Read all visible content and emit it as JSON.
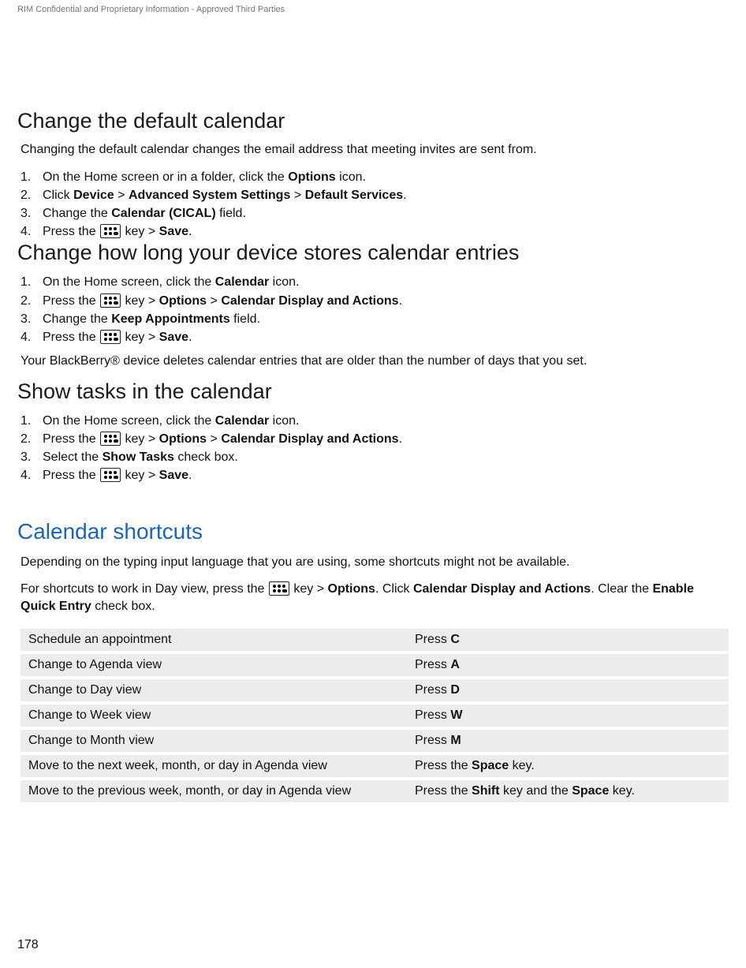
{
  "header": "RIM Confidential and Proprietary Information - Approved Third Parties",
  "page_number": "178",
  "key_label": "key",
  "gt": ">",
  "sections": {
    "s1": {
      "title": "Change the default calendar",
      "intro": "Changing the default calendar changes the email address that meeting invites are sent from.",
      "step1_a": "On the Home screen or in a folder, click the ",
      "step1_b": "Options",
      "step1_c": " icon.",
      "step2_a": "Click ",
      "step2_b": "Device",
      "step2_c": "Advanced System Settings",
      "step2_d": "Default Services",
      "step3_a": "Change the ",
      "step3_b": "Calendar (CICAL)",
      "step3_c": " field.",
      "step4_a": "Press the ",
      "step4_b": "Save"
    },
    "s2": {
      "title": "Change how long your device stores calendar entries",
      "step1_a": "On the Home screen, click the ",
      "step1_b": "Calendar",
      "step1_c": " icon.",
      "step2_a": "Press the ",
      "step2_b": "Options",
      "step2_c": "Calendar Display and Actions",
      "step3_a": "Change the ",
      "step3_b": "Keep Appointments",
      "step3_c": " field.",
      "step4_a": "Press the ",
      "step4_b": "Save",
      "outro": "Your BlackBerry® device deletes calendar entries that are older than the number of days that you set."
    },
    "s3": {
      "title": "Show tasks in the calendar",
      "step1_a": "On the Home screen, click the ",
      "step1_b": "Calendar",
      "step1_c": " icon.",
      "step2_a": "Press the ",
      "step2_b": "Options",
      "step2_c": "Calendar Display and Actions",
      "step3_a": "Select the ",
      "step3_b": "Show Tasks",
      "step3_c": " check box.",
      "step4_a": "Press the ",
      "step4_b": "Save"
    },
    "s4": {
      "title": "Calendar shortcuts",
      "p1": "Depending on the typing input language that you are using, some shortcuts might not be available.",
      "p2_a": "For shortcuts to work in Day view, press the ",
      "p2_b": "Options",
      "p2_c": ". Click ",
      "p2_d": "Calendar Display and Actions",
      "p2_e": ". Clear the ",
      "p2_f": "Enable Quick Entry",
      "p2_g": " check box."
    }
  },
  "table": {
    "rows": [
      {
        "action": "Schedule an appointment",
        "press": "Press ",
        "key": "C",
        "suffix": ""
      },
      {
        "action": "Change to Agenda view",
        "press": "Press ",
        "key": "A",
        "suffix": ""
      },
      {
        "action": "Change to Day view",
        "press": "Press ",
        "key": "D",
        "suffix": ""
      },
      {
        "action": "Change to Week view",
        "press": "Press ",
        "key": "W",
        "suffix": ""
      },
      {
        "action": "Change to Month view",
        "press": "Press ",
        "key": "M",
        "suffix": ""
      },
      {
        "action": "Move to the next week, month, or day in Agenda view",
        "press": "Press the ",
        "key": "Space",
        "suffix": " key."
      },
      {
        "action": "Move to the previous week, month, or day in Agenda view",
        "press": "Press the ",
        "key": "Shift",
        "mid": " key and the ",
        "key2": "Space",
        "suffix": " key."
      }
    ]
  }
}
